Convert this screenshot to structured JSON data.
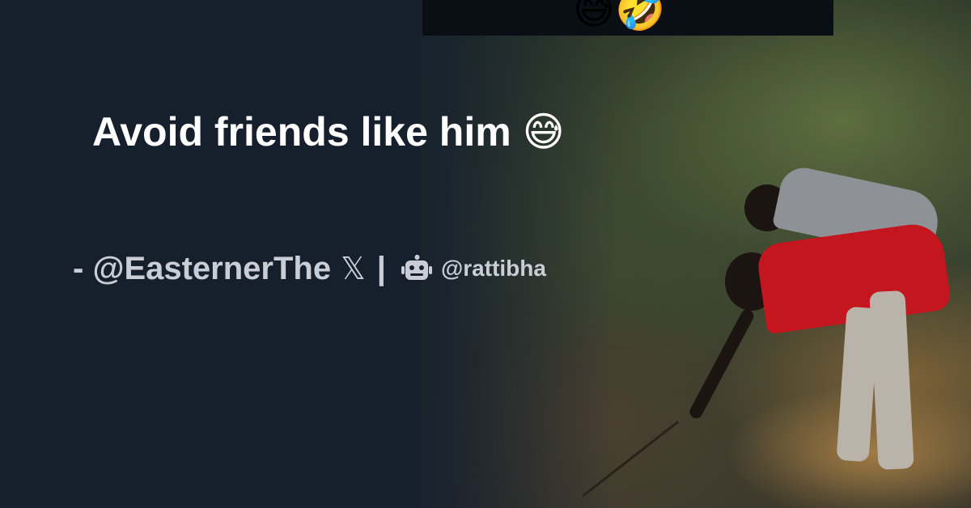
{
  "post": {
    "title_text": "Avoid friends like him",
    "title_emoji": "😅",
    "author_prefix": "- ",
    "author_handle": "@EasternerThe",
    "platform_icon": "x-logo-icon",
    "platform_glyph": "𝕏",
    "separator": "|",
    "brand_icon": "robot-icon",
    "brand_handle": "@rattibha"
  },
  "media": {
    "caption_emojis": "😅🤣",
    "description_colors": {
      "background": "#16202d",
      "text": "#ffffff",
      "credit_text": "#c9ced6",
      "shirt_red": "#c4161e"
    }
  }
}
